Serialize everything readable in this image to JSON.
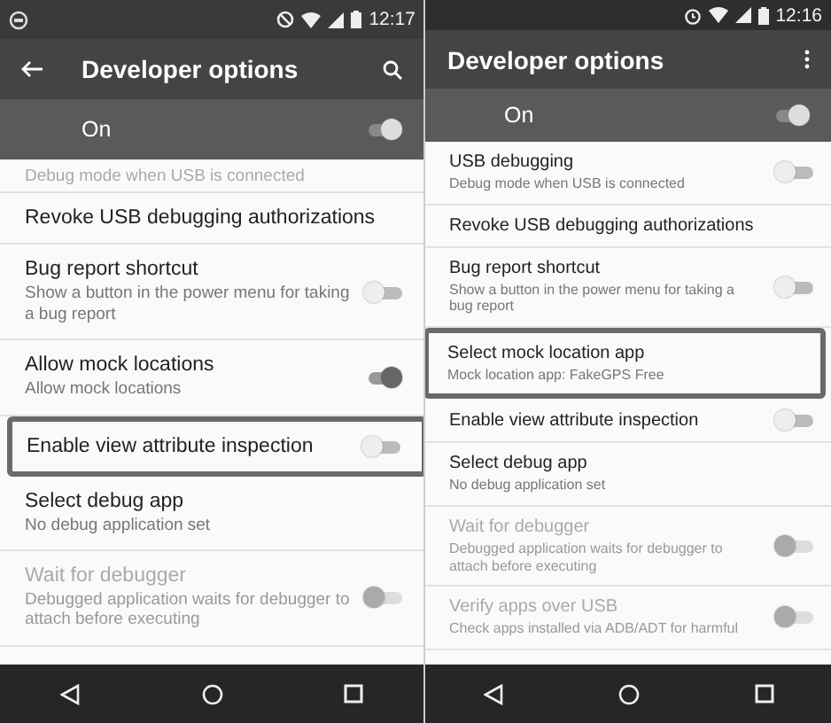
{
  "screens": [
    {
      "status_bar": {
        "time": "12:17",
        "icons": [
          {
            "kind": "app"
          },
          {
            "kind": "block"
          },
          {
            "kind": "wifi"
          },
          {
            "kind": "signal"
          },
          {
            "kind": "battery"
          }
        ]
      },
      "toolbar": {
        "title": "Developer options",
        "back": true,
        "action": {
          "kind": "search"
        }
      },
      "master_switch": {
        "label": "On",
        "on": true
      },
      "items": [
        {
          "kind": "plain",
          "summary": "Debug mode when USB is connected",
          "highlighted": false,
          "disabled": false
        },
        {
          "kind": "plain",
          "title": "Revoke USB debugging authorizations",
          "highlighted": false,
          "disabled": false
        },
        {
          "kind": "switch",
          "title": "Bug report shortcut",
          "summary": "Show a button in the power menu for taking a bug report",
          "on": false,
          "highlighted": false,
          "disabled": false
        },
        {
          "kind": "switch",
          "title": "Allow mock locations",
          "summary": "Allow mock locations",
          "on": true,
          "highlighted": false,
          "disabled": false
        },
        {
          "kind": "switch",
          "title": "Enable view attribute inspection",
          "on": false,
          "highlighted": true,
          "disabled": false
        },
        {
          "kind": "plain",
          "title": "Select debug app",
          "summary": "No debug application set",
          "highlighted": false,
          "disabled": false
        },
        {
          "kind": "switch",
          "title": "Wait for debugger",
          "summary": "Debugged application waits for debugger to attach before executing",
          "on": false,
          "highlighted": false,
          "disabled": true
        }
      ]
    },
    {
      "status_bar": {
        "time": "12:16",
        "icons": [
          {
            "kind": "alarm"
          },
          {
            "kind": "wifi"
          },
          {
            "kind": "signal"
          },
          {
            "kind": "battery"
          }
        ]
      },
      "toolbar": {
        "title": "Developer options",
        "back": false,
        "action": {
          "kind": "overflow"
        }
      },
      "master_switch": {
        "label": "On",
        "on": true
      },
      "items": [
        {
          "kind": "switch",
          "title": "USB debugging",
          "summary": "Debug mode when USB is connected",
          "on": false,
          "highlighted": false,
          "disabled": false
        },
        {
          "kind": "plain",
          "title": "Revoke USB debugging authorizations",
          "highlighted": false,
          "disabled": false
        },
        {
          "kind": "switch",
          "title": "Bug report shortcut",
          "summary": "Show a button in the power menu for taking a bug report",
          "on": false,
          "highlighted": false,
          "disabled": false
        },
        {
          "kind": "plain",
          "title": "Select mock location app",
          "summary": "Mock location app: FakeGPS Free",
          "highlighted": true,
          "disabled": false
        },
        {
          "kind": "switch",
          "title": "Enable view attribute inspection",
          "on": false,
          "highlighted": false,
          "disabled": false
        },
        {
          "kind": "plain",
          "title": "Select debug app",
          "summary": "No debug application set",
          "highlighted": false,
          "disabled": false
        },
        {
          "kind": "switch",
          "title": "Wait for debugger",
          "summary": "Debugged application waits for debugger to attach before executing",
          "on": false,
          "highlighted": false,
          "disabled": true
        },
        {
          "kind": "switch",
          "title": "Verify apps over USB",
          "summary": "Check apps installed via ADB/ADT for harmful",
          "on": false,
          "highlighted": false,
          "disabled": true
        }
      ]
    }
  ]
}
